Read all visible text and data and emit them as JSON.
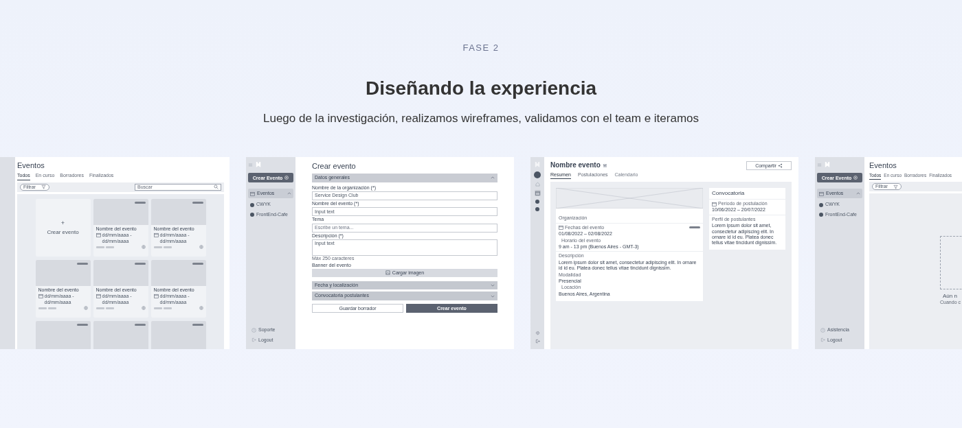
{
  "header": {
    "eyebrow": "FASE 2",
    "title": "Diseñando la experiencia",
    "subtitle": "Luego de la investigación, realizamos wireframes, validamos con el team e iteramos"
  },
  "screens": [
    {
      "kind": "event-list",
      "title": "Eventos",
      "tabs": [
        {
          "label": "Todos",
          "selected": true
        },
        {
          "label": "En curso",
          "selected": false
        },
        {
          "label": "Borradores",
          "selected": false
        },
        {
          "label": "Finalizados",
          "selected": false
        }
      ],
      "filter": {
        "placeholder": "Filtrar"
      },
      "search": {
        "placeholder": "Buscar"
      },
      "cards": [
        {
          "kind": "create",
          "icon_text": "+",
          "label": "Crear evento"
        },
        {
          "kind": "event",
          "name": "Nombre del evento",
          "dates": "dd/mm/aaaa - dd/mm/aaaa"
        },
        {
          "kind": "event",
          "name": "Nombre del evento",
          "dates": "dd/mm/aaaa - dd/mm/aaaa"
        },
        {
          "kind": "event",
          "name": "Nombre del evento",
          "dates": "dd/mm/aaaa - dd/mm/aaaa"
        },
        {
          "kind": "event",
          "name": "Nombre del evento",
          "dates": "dd/mm/aaaa - dd/mm/aaaa"
        },
        {
          "kind": "event",
          "name": "Nombre del evento",
          "dates": "dd/mm/aaaa - dd/mm/aaaa"
        },
        {
          "kind": "event"
        },
        {
          "kind": "event"
        },
        {
          "kind": "event"
        }
      ]
    },
    {
      "kind": "create-form",
      "sidebar": {
        "create_button": "Crear Evento",
        "items": [
          {
            "label": "Eventos",
            "expanded": true,
            "children": [
              {
                "label": "CWYK"
              },
              {
                "label": "FrontEnd-Cafe"
              }
            ]
          }
        ],
        "footer": [
          "Soporte",
          "Logout"
        ]
      },
      "title": "Crear evento",
      "sections": [
        {
          "title": "Datos generales",
          "expanded": true
        },
        {
          "title": "Fecha y localización",
          "expanded": false
        },
        {
          "title": "Convocatoria postulantes",
          "expanded": false
        }
      ],
      "fields": [
        {
          "kind": "input",
          "label": "Nombre de la organización (*)",
          "value": "Service Design Club"
        },
        {
          "kind": "input",
          "label": "Nombre del evento (*)",
          "value": "Input text"
        },
        {
          "kind": "input",
          "label": "Tema",
          "placeholder": "Escribe un tema..."
        },
        {
          "kind": "textarea",
          "label": "Descripción (*)",
          "value": "Input text",
          "hint": "Máx 250 caracteres"
        },
        {
          "kind": "upload",
          "label": "Banner del evento",
          "button": "Cargar imagen"
        }
      ],
      "buttons": [
        {
          "label": "Guardar borrador",
          "kind": "secondary"
        },
        {
          "label": "Crear evento",
          "kind": "primary"
        }
      ]
    },
    {
      "kind": "event-detail",
      "title": "Nombre evento",
      "share": "Compartir",
      "tabs": [
        {
          "label": "Resumen",
          "selected": true,
          "disabled": false
        },
        {
          "label": "Postulaciones",
          "selected": false,
          "disabled": false
        },
        {
          "label": "Calendario",
          "selected": false,
          "disabled": true
        }
      ],
      "organization": "Organización",
      "dates_label": "Fechas del evento",
      "dates": "01/08/2022 – 02/08/2022",
      "time_label": "Horario del evento",
      "time": "9 am - 13 pm (Buenos Aires - GMT-3)",
      "description_label": "Descripción",
      "description": "Lorem ipsum dolor sit amet, consectetur adipiscing elit. In ornare id id eu. Platea donec tellus vitae tincidunt dignissim.",
      "mode_label": "Modalidad",
      "mode": "Presencial",
      "location_label": "Locación",
      "location": "Buenos Aires, Argentina",
      "call": {
        "title": "Convocatoria",
        "period_label": "Período de postulación",
        "period": "10/06/2022 – 20/07/2022",
        "profile_label": "Perfil de postulantes",
        "profile": "Lorem ipsum dolor sit amet, consectetur adipiscing elit. In ornare id id eu. Platea donec tellus vitae tincidunt dignissim."
      }
    },
    {
      "kind": "empty-list",
      "sidebar": {
        "create_button": "Crear Evento",
        "items": [
          {
            "label": "Eventos",
            "expanded": true,
            "children": [
              {
                "label": "CWYK"
              },
              {
                "label": "FrontEnd-Cafe"
              }
            ]
          }
        ],
        "footer": [
          "Asistencia",
          "Logout"
        ]
      },
      "title": "Eventos",
      "tabs": [
        {
          "label": "Todos",
          "selected": true
        },
        {
          "label": "En curso",
          "selected": false
        },
        {
          "label": "Borradores",
          "selected": false
        },
        {
          "label": "Finalizados",
          "selected": false
        }
      ],
      "filter": {
        "placeholder": "Filtrar"
      },
      "empty": {
        "title": "Aún n",
        "text": "Cuando c"
      }
    }
  ]
}
